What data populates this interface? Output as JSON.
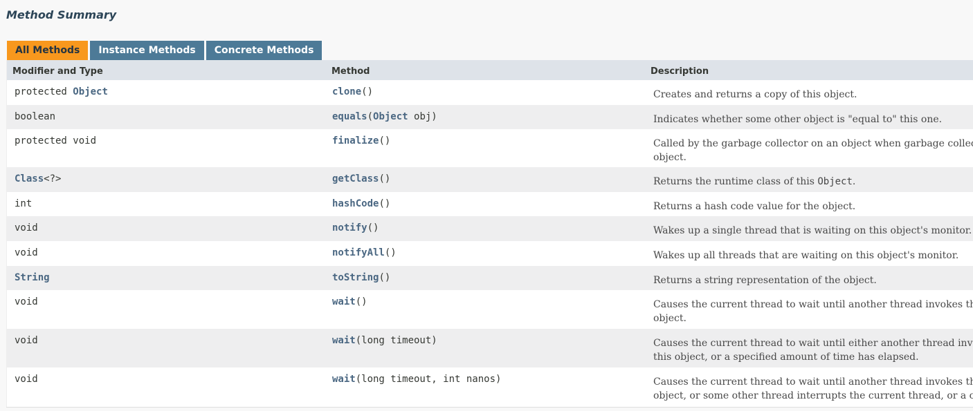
{
  "page": {
    "title": "Method Summary"
  },
  "tabs": [
    {
      "label": "All Methods",
      "active": true
    },
    {
      "label": "Instance Methods",
      "active": false
    },
    {
      "label": "Concrete Methods",
      "active": false
    }
  ],
  "colors": {
    "active_tab": "#f8981d",
    "tab": "#4d7a97",
    "header": "#dee3e9",
    "link": "#4a6782",
    "alt_row": "#eeeeef"
  },
  "columns": {
    "type": "Modifier and Type",
    "method": "Method",
    "description": "Description"
  },
  "rows": [
    {
      "type_pre": "protected ",
      "type_link": "Object",
      "type_post": "",
      "method_name": "clone",
      "method_params": "()",
      "desc": [
        "Creates and returns a copy of this object."
      ]
    },
    {
      "type_pre": "boolean",
      "type_link": "",
      "type_post": "",
      "method_name": "equals",
      "method_params_pre": "(",
      "method_params_link": "Object",
      "method_params": " obj)",
      "desc": [
        "Indicates whether some other object is \"equal to\" this one."
      ]
    },
    {
      "type_pre": "protected void",
      "type_link": "",
      "type_post": "",
      "method_name": "finalize",
      "method_params": "()",
      "desc": [
        "Called by the garbage collector on an object when garbage collec",
        "object."
      ]
    },
    {
      "type_pre": "",
      "type_link": "Class",
      "type_post": "<?>",
      "method_name": "getClass",
      "method_params": "()",
      "desc_pre": "Returns the runtime class of this ",
      "desc_code": "Object",
      "desc_post": "."
    },
    {
      "type_pre": "int",
      "type_link": "",
      "type_post": "",
      "method_name": "hashCode",
      "method_params": "()",
      "desc": [
        "Returns a hash code value for the object."
      ]
    },
    {
      "type_pre": "void",
      "type_link": "",
      "type_post": "",
      "method_name": "notify",
      "method_params": "()",
      "desc": [
        "Wakes up a single thread that is waiting on this object's monitor."
      ]
    },
    {
      "type_pre": "void",
      "type_link": "",
      "type_post": "",
      "method_name": "notifyAll",
      "method_params": "()",
      "desc": [
        "Wakes up all threads that are waiting on this object's monitor."
      ]
    },
    {
      "type_pre": "",
      "type_link": "String",
      "type_post": "",
      "method_name": "toString",
      "method_params": "()",
      "desc": [
        "Returns a string representation of the object."
      ]
    },
    {
      "type_pre": "void",
      "type_link": "",
      "type_post": "",
      "method_name": "wait",
      "method_params": "()",
      "desc": [
        "Causes the current thread to wait until another thread invokes th",
        "object."
      ]
    },
    {
      "type_pre": "void",
      "type_link": "",
      "type_post": "",
      "method_name": "wait",
      "method_params": "(long timeout)",
      "desc": [
        "Causes the current thread to wait until either another thread invo",
        "this object, or a specified amount of time has elapsed."
      ]
    },
    {
      "type_pre": "void",
      "type_link": "",
      "type_post": "",
      "method_name": "wait",
      "method_params": "(long timeout, int nanos)",
      "desc": [
        "Causes the current thread to wait until another thread invokes th",
        "object, or some other thread interrupts the current thread, or a c"
      ]
    }
  ]
}
